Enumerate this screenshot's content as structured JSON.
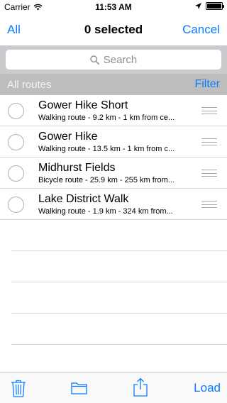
{
  "status_bar": {
    "carrier": "Carrier",
    "time": "11:53 AM"
  },
  "nav": {
    "left_label": "All",
    "title": "0 selected",
    "right_label": "Cancel"
  },
  "search": {
    "placeholder": "Search"
  },
  "section": {
    "title": "All routes",
    "filter_label": "Filter"
  },
  "routes": [
    {
      "title": "Gower Hike Short",
      "subtitle": "Walking route - 9.2 km - 1 km from ce..."
    },
    {
      "title": "Gower Hike",
      "subtitle": "Walking route - 13.5 km - 1 km from c..."
    },
    {
      "title": "Midhurst Fields",
      "subtitle": "Bicycle route - 25.9 km - 255 km from..."
    },
    {
      "title": "Lake District Walk",
      "subtitle": "Walking route - 1.9 km - 324 km from..."
    }
  ],
  "toolbar": {
    "load_label": "Load",
    "icons": [
      "trash-icon",
      "folder-icon",
      "share-icon"
    ]
  },
  "colors": {
    "accent": "#0a7aff",
    "section_header_bg": "#bdbdbd",
    "search_bar_bg": "#c9c9ce"
  }
}
